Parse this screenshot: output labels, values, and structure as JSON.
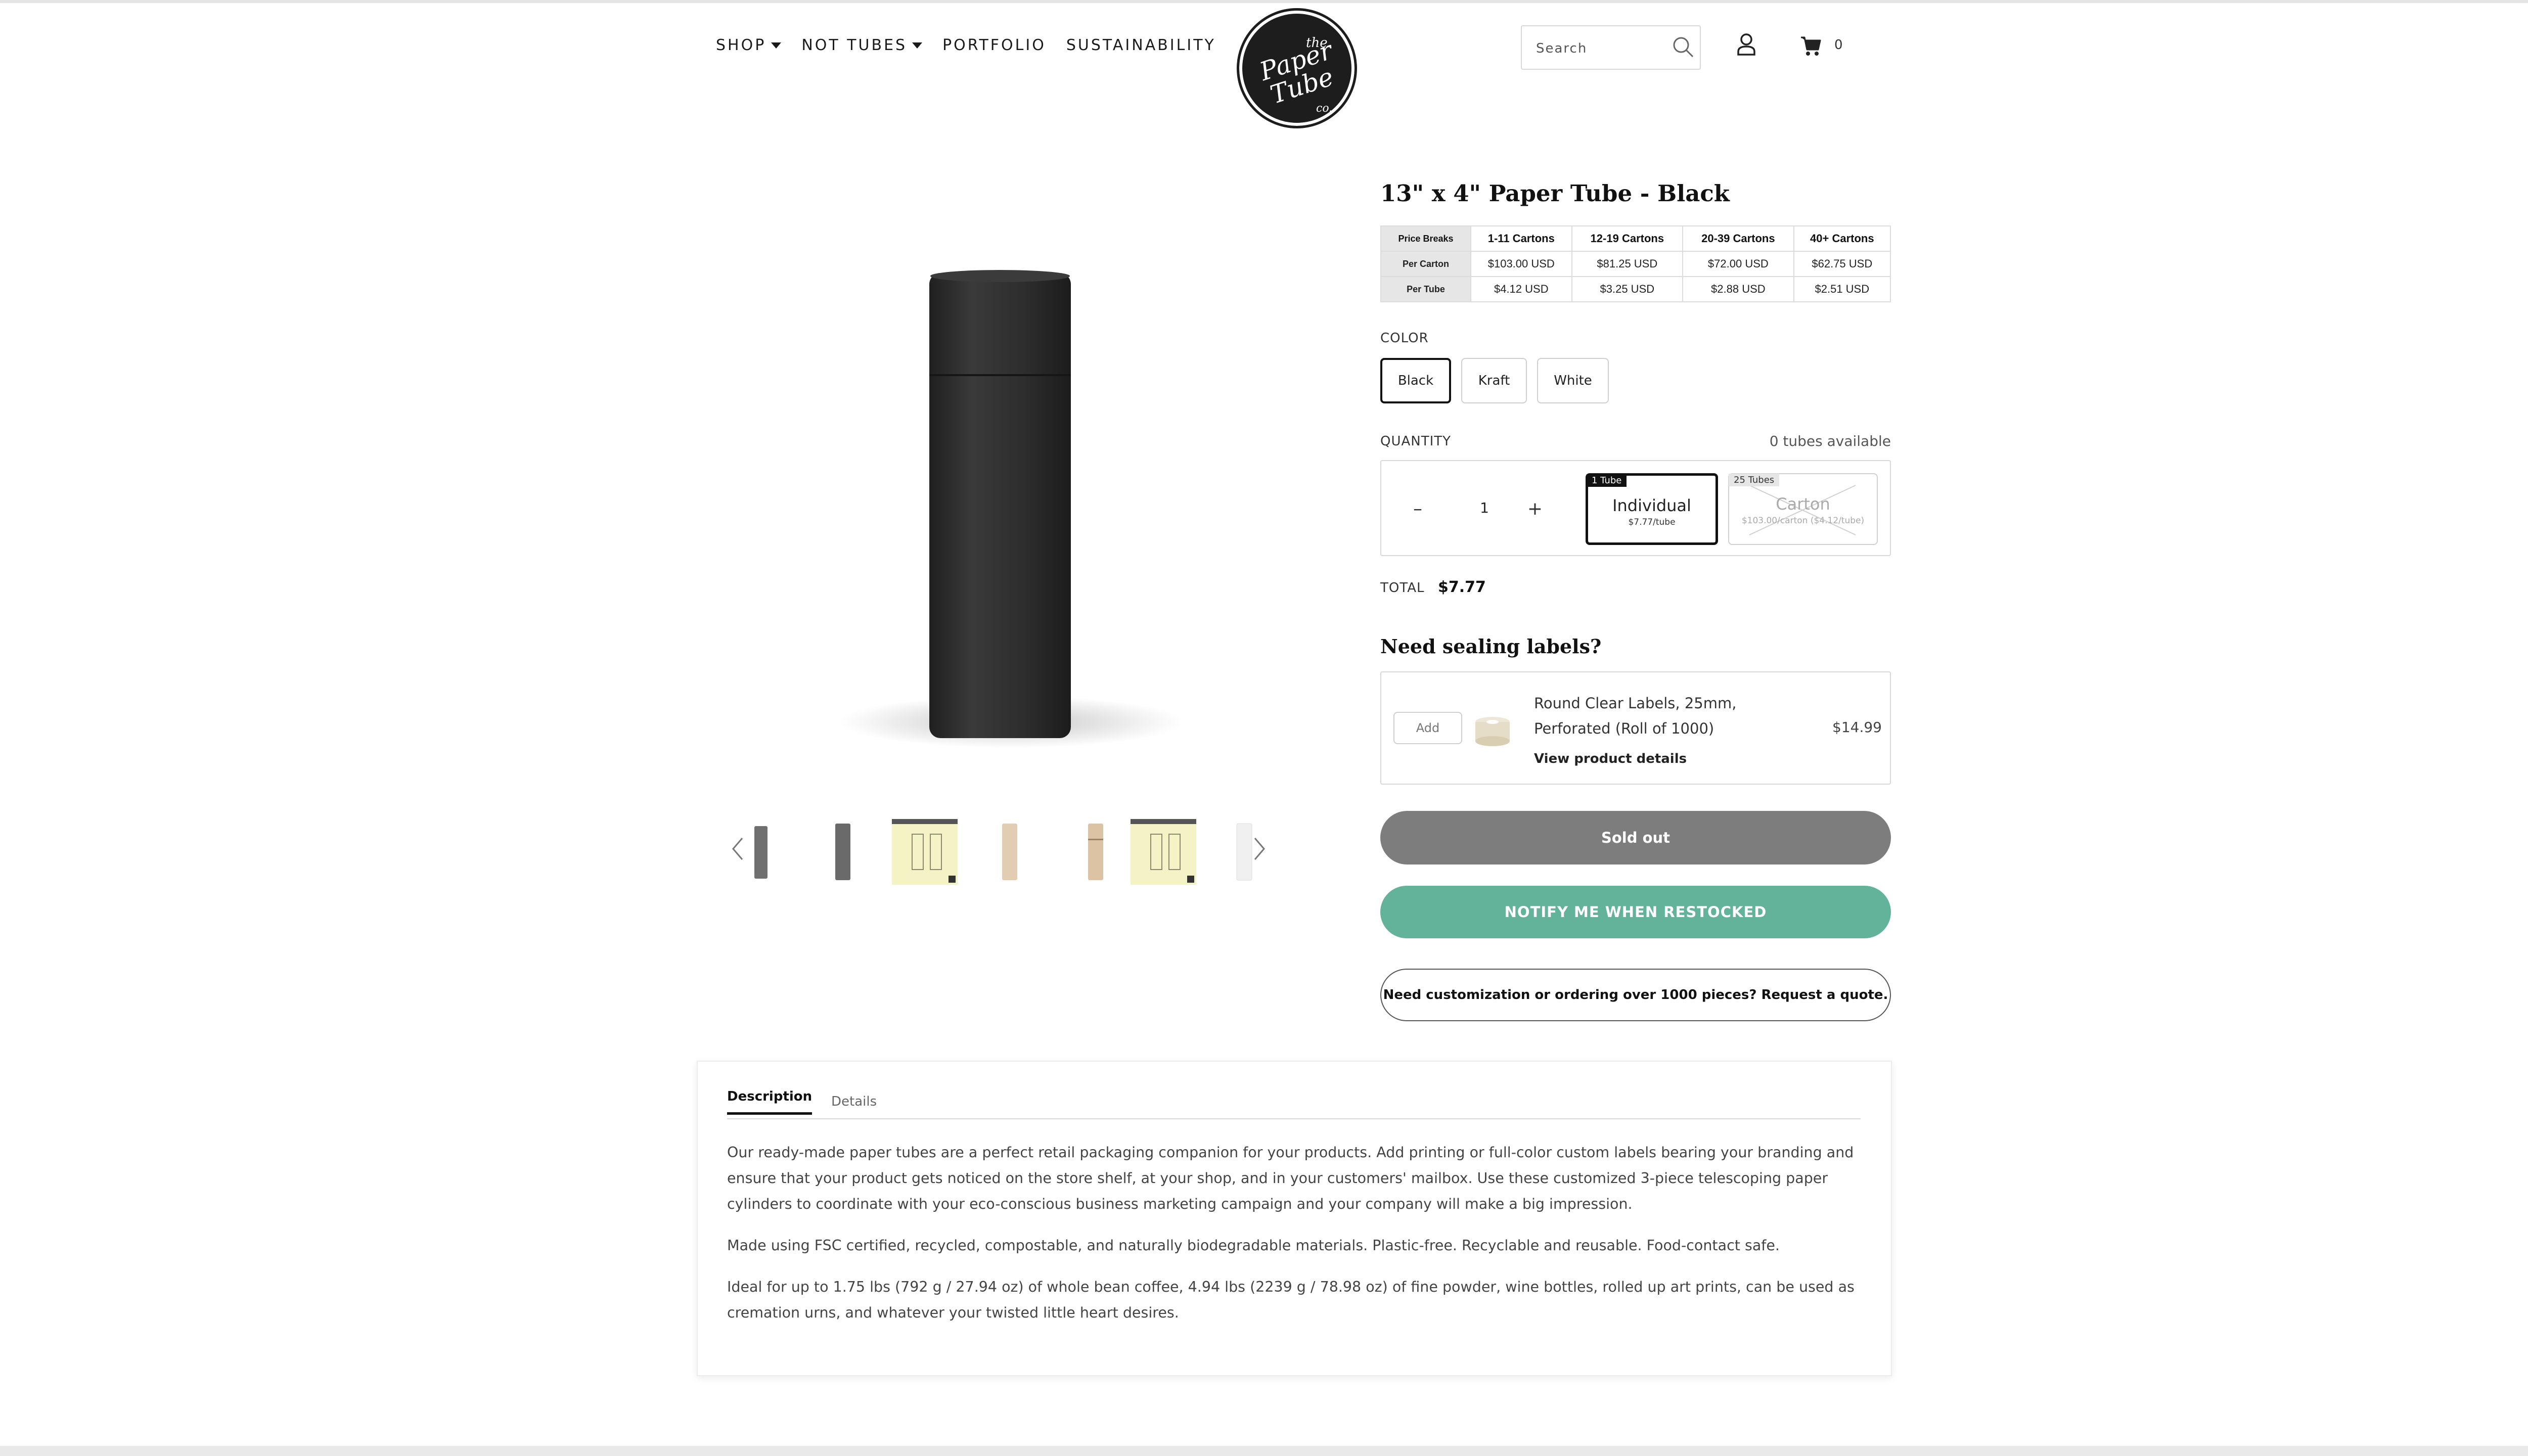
{
  "header": {
    "nav": [
      {
        "label": "SHOP",
        "has_caret": true
      },
      {
        "label": "NOT TUBES",
        "has_caret": true
      },
      {
        "label": "PORTFOLIO",
        "has_caret": false
      },
      {
        "label": "SUSTAINABILITY",
        "has_caret": false
      }
    ],
    "logo_text": [
      "the",
      "Paper",
      "Tube",
      "co."
    ],
    "search_placeholder": "Search",
    "cart_count": "0",
    "icons": [
      "search-icon",
      "account-icon",
      "cart-icon"
    ]
  },
  "gallery": {
    "thumbnails": [
      "grey tube",
      "grey tube",
      "spec sheet",
      "kraft tube",
      "kraft tube",
      "spec sheet",
      "white tube"
    ],
    "prev_icon": "chevron-left-icon",
    "next_icon": "chevron-right-icon"
  },
  "product": {
    "title": "13\" x 4\" Paper Tube - Black",
    "price_table": {
      "headers": [
        "Price Breaks",
        "1-11 Cartons",
        "12-19 Cartons",
        "20-39 Cartons",
        "40+ Cartons"
      ],
      "rows": [
        {
          "label": "Per Carton",
          "values": [
            "$103.00 USD",
            "$81.25 USD",
            "$72.00 USD",
            "$62.75 USD"
          ]
        },
        {
          "label": "Per Tube",
          "values": [
            "$4.12 USD",
            "$3.25 USD",
            "$2.88 USD",
            "$2.51 USD"
          ]
        }
      ]
    },
    "color_label": "COLOR",
    "colors": [
      "Black",
      "Kraft",
      "White"
    ],
    "selected_color": "Black",
    "quantity_label": "QUANTITY",
    "availability": "0 tubes available",
    "quantity": {
      "minus": "–",
      "value": "1",
      "plus": "+"
    },
    "options": [
      {
        "tag": "1 Tube",
        "name": "Individual",
        "price": "$7.77/tube",
        "selected": true
      },
      {
        "tag": "25 Tubes",
        "name": "Carton",
        "price": "$103.00/carton ($4.12/tube)",
        "selected": false
      }
    ],
    "total_label": "TOTAL",
    "total_value": "$7.77"
  },
  "addon": {
    "heading": "Need sealing labels?",
    "add_label": "Add",
    "name": "Round Clear Labels, 25mm, Perforated (Roll of 1000)",
    "link": "View product details",
    "price": "$14.99"
  },
  "actions": {
    "sold_out": "Sold out",
    "notify": "NOTIFY ME WHEN RESTOCKED",
    "quote": "Need customization or ordering over 1000 pieces? Request a quote."
  },
  "description": {
    "tabs": [
      "Description",
      "Details"
    ],
    "paragraphs": [
      "Our ready-made paper tubes are a perfect retail packaging companion for your products. Add printing or full-color custom labels bearing your branding and ensure that your product gets noticed on the store shelf, at your shop, and in your customers' mailbox. Use these customized 3-piece telescoping paper cylinders to coordinate with your eco-conscious business marketing campaign and your company will make a big impression.",
      "Made using FSC certified, recycled, compostable, and naturally biodegradable materials. Plastic-free. Recyclable and reusable. Food-contact safe.",
      "Ideal for up to 1.75 lbs (792 g / 27.94 oz) of whole bean coffee, 4.94 lbs (2239 g / 78.98 oz) of fine powder, wine bottles, rolled up art prints, can be used as cremation urns, and whatever your twisted little heart desires."
    ]
  },
  "colors": {
    "notify_bg": "#63b39a",
    "sold_out_bg": "#7d7d7d",
    "logo_bg": "#1d1d1d"
  }
}
